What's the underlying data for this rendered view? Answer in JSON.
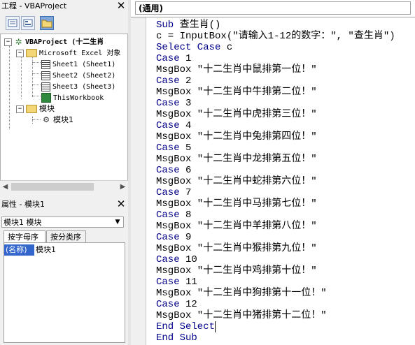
{
  "project_panel": {
    "title": "工程 - VBAProject",
    "tree": {
      "root": "VBAProject (十二生肖",
      "excel_objects": "Microsoft Excel 对象",
      "sheets": [
        "Sheet1 (Sheet1)",
        "Sheet2 (Sheet2)",
        "Sheet3 (Sheet3)"
      ],
      "workbook": "ThisWorkbook",
      "modules_folder": "模块",
      "module": "模块1"
    }
  },
  "properties_panel": {
    "title": "属性 - 模块1",
    "object_select": "模块1 模块",
    "tabs": [
      "按字母序",
      "按分类序"
    ],
    "row": {
      "key": "(名称)",
      "value": "模块1"
    }
  },
  "code_window": {
    "combo": "(通用)",
    "lines": [
      {
        "kw": "Sub",
        "rest": " 查生肖()"
      },
      {
        "kw": "",
        "rest": "c = InputBox(\"请输入1-12的数字：\", \"查生肖\")"
      },
      {
        "kw": "Select Case",
        "rest": " c"
      },
      {
        "kw": "Case",
        "rest": " 1"
      },
      {
        "kw": "",
        "rest": "MsgBox \"十二生肖中鼠排第一位！\""
      },
      {
        "kw": "Case",
        "rest": " 2"
      },
      {
        "kw": "",
        "rest": "MsgBox \"十二生肖中牛排第二位！\""
      },
      {
        "kw": "Case",
        "rest": " 3"
      },
      {
        "kw": "",
        "rest": "MsgBox \"十二生肖中虎排第三位！\""
      },
      {
        "kw": "Case",
        "rest": " 4"
      },
      {
        "kw": "",
        "rest": "MsgBox \"十二生肖中兔排第四位！\""
      },
      {
        "kw": "Case",
        "rest": " 5"
      },
      {
        "kw": "",
        "rest": "MsgBox \"十二生肖中龙排第五位！\""
      },
      {
        "kw": "Case",
        "rest": " 6"
      },
      {
        "kw": "",
        "rest": "MsgBox \"十二生肖中蛇排第六位！\""
      },
      {
        "kw": "Case",
        "rest": " 7"
      },
      {
        "kw": "",
        "rest": "MsgBox \"十二生肖中马排第七位！\""
      },
      {
        "kw": "Case",
        "rest": " 8"
      },
      {
        "kw": "",
        "rest": "MsgBox \"十二生肖中羊排第八位！\""
      },
      {
        "kw": "Case",
        "rest": " 9"
      },
      {
        "kw": "",
        "rest": "MsgBox \"十二生肖中猴排第九位！\""
      },
      {
        "kw": "Case",
        "rest": " 10"
      },
      {
        "kw": "",
        "rest": "MsgBox \"十二生肖中鸡排第十位！\""
      },
      {
        "kw": "Case",
        "rest": " 11"
      },
      {
        "kw": "",
        "rest": "MsgBox \"十二生肖中狗排第十一位！\""
      },
      {
        "kw": "Case",
        "rest": " 12"
      },
      {
        "kw": "",
        "rest": "MsgBox \"十二生肖中猪排第十二位！\""
      },
      {
        "kw": "End Select",
        "rest": ""
      },
      {
        "kw": "End Sub",
        "rest": ""
      }
    ]
  }
}
